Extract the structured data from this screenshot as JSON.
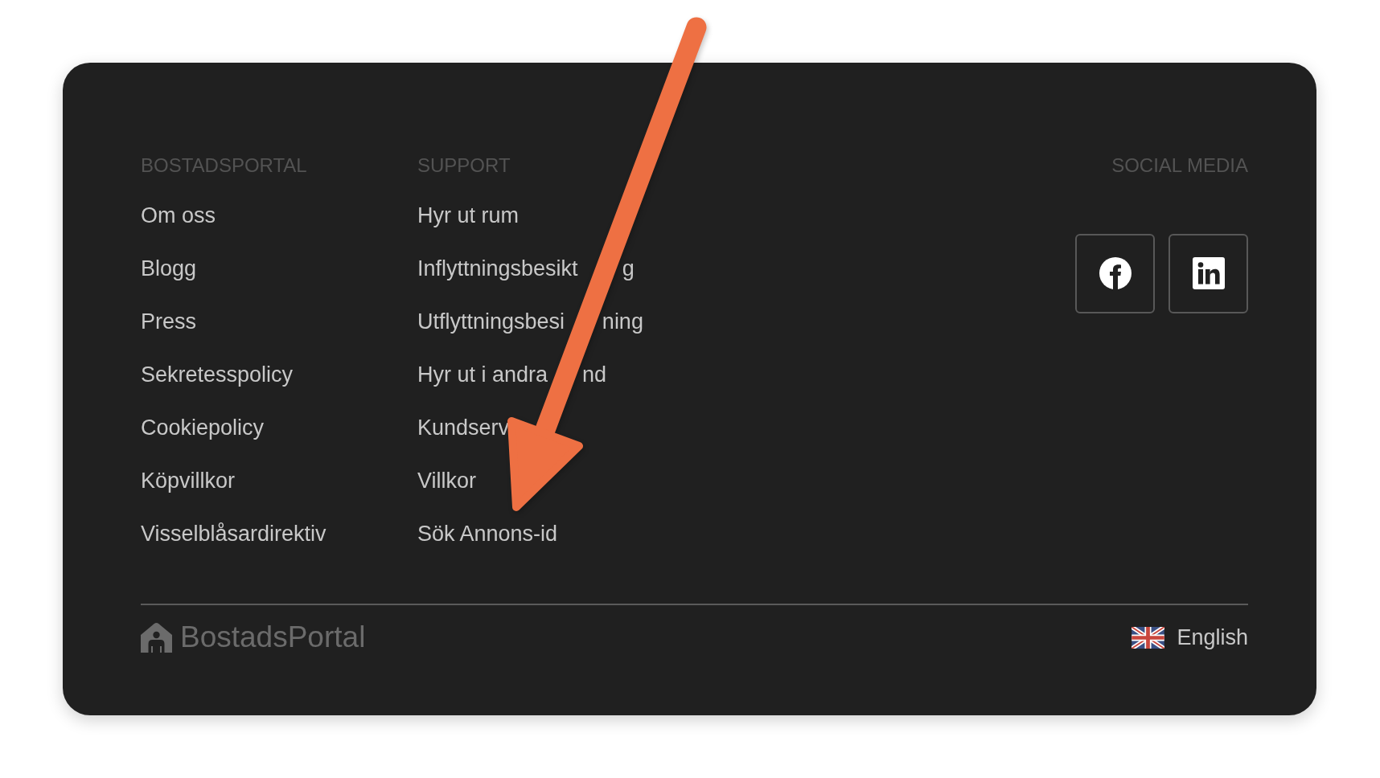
{
  "columns": [
    {
      "heading": "BOSTADSPORTAL",
      "links": [
        {
          "text": "Om oss"
        },
        {
          "text": "Blogg"
        },
        {
          "text": "Press"
        },
        {
          "text": "Sekretesspolicy"
        },
        {
          "text": "Cookiepolicy"
        },
        {
          "text": "Köpvillkor"
        },
        {
          "text": "Visselblåsardirektiv"
        }
      ]
    },
    {
      "heading": "SUPPORT",
      "links": [
        {
          "text": "Hyr ut rum"
        },
        {
          "text": "Inflyttningsbesikt",
          "after_arrow": "g"
        },
        {
          "text": "Utflyttningsbesi",
          "after_arrow": "ning"
        },
        {
          "text": "Hyr ut i andra",
          "after_arrow": "nd"
        },
        {
          "text": "Kundserv"
        },
        {
          "text": "Villkor"
        },
        {
          "text": "Sök Annons-id"
        }
      ]
    }
  ],
  "social": {
    "heading": "SOCIAL MEDIA",
    "buttons": [
      {
        "kind": "facebook"
      },
      {
        "kind": "linkedin"
      }
    ]
  },
  "footer": {
    "logo_text": "BostadsPortal",
    "language": "English"
  },
  "annotation": {
    "kind": "arrow"
  }
}
